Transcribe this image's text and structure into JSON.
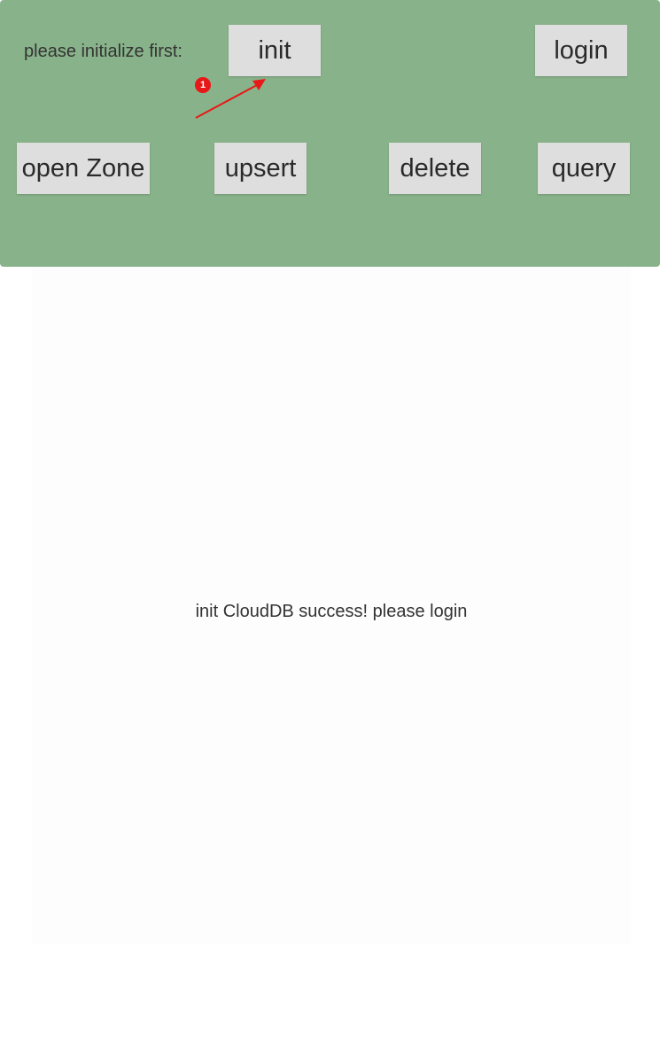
{
  "colors": {
    "toolbar_background": "#88b38a",
    "button_background": "#dedede",
    "annotation": "#e81818"
  },
  "toolbar": {
    "prompt_label": "please initialize first:",
    "buttons": {
      "init": "init",
      "login": "login",
      "open_zone": "open Zone",
      "upsert": "upsert",
      "delete": "delete",
      "query": "query"
    }
  },
  "annotation": {
    "step_number": "1"
  },
  "result": {
    "message": "init CloudDB success! please login"
  }
}
